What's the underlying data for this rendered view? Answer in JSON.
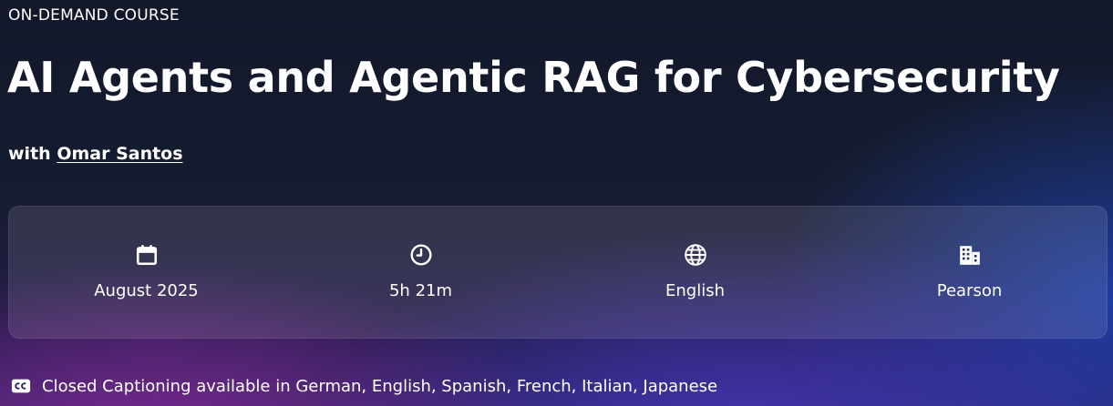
{
  "course": {
    "type_label": "ON-DEMAND COURSE",
    "title": "AI Agents and Agentic RAG for Cybersecurity",
    "byline_prefix": "with",
    "author": "Omar Santos"
  },
  "meta": [
    {
      "icon": "calendar-icon",
      "value": "August 2025"
    },
    {
      "icon": "clock-icon",
      "value": "5h 21m"
    },
    {
      "icon": "globe-icon",
      "value": "English"
    },
    {
      "icon": "building-icon",
      "value": "Pearson"
    }
  ],
  "captions": {
    "icon": "closed-caption-icon",
    "text": "Closed Captioning available in German, English, Spanish, French, Italian, Japanese"
  },
  "colors": {
    "background_top": "#12182a",
    "accent_purple": "#842896",
    "accent_blue": "#4637be",
    "text": "#ffffff"
  }
}
